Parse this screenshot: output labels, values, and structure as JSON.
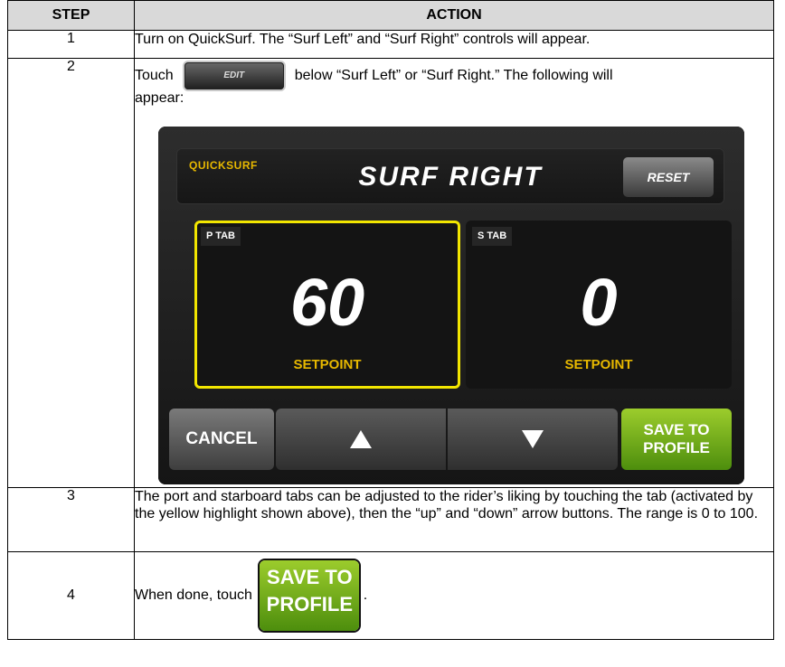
{
  "table": {
    "headers": [
      "STEP",
      "ACTION"
    ],
    "rows": [
      {
        "step": "1",
        "text": "Turn on QuickSurf. The “Surf Left” and “Surf Right” controls will appear."
      },
      {
        "step": "2",
        "before": "Touch",
        "after": "below “Surf Left” or “Surf Right.” The following will",
        "after2": "appear:"
      },
      {
        "step": "3",
        "text": "The port and starboard tabs can be adjusted to the rider’s liking by touching the tab (activated by the yellow highlight shown above), then the “up” and “down” arrow buttons. The range is 0 to 100."
      },
      {
        "step": "4",
        "before": "When done, touch",
        "after": "."
      }
    ]
  },
  "edit_button_label": "EDIT",
  "device": {
    "app_label": "QUICKSURF",
    "title": "SURF RIGHT",
    "reset_label": "RESET",
    "port_tab": {
      "label": "P TAB",
      "value": "60",
      "caption": "SETPOINT",
      "selected": true
    },
    "starboard_tab": {
      "label": "S TAB",
      "value": "0",
      "caption": "SETPOINT",
      "selected": false
    },
    "cancel_label": "CANCEL",
    "up_icon": "up-arrow-icon",
    "down_icon": "down-arrow-icon",
    "save_label_line1": "SAVE TO",
    "save_label_line2": "PROFILE",
    "highlight_color": "#f2e600",
    "accent_color": "#e7b800",
    "save_color": "#6aab1a"
  },
  "inline_save": {
    "line1": "SAVE TO",
    "line2": "PROFILE"
  }
}
